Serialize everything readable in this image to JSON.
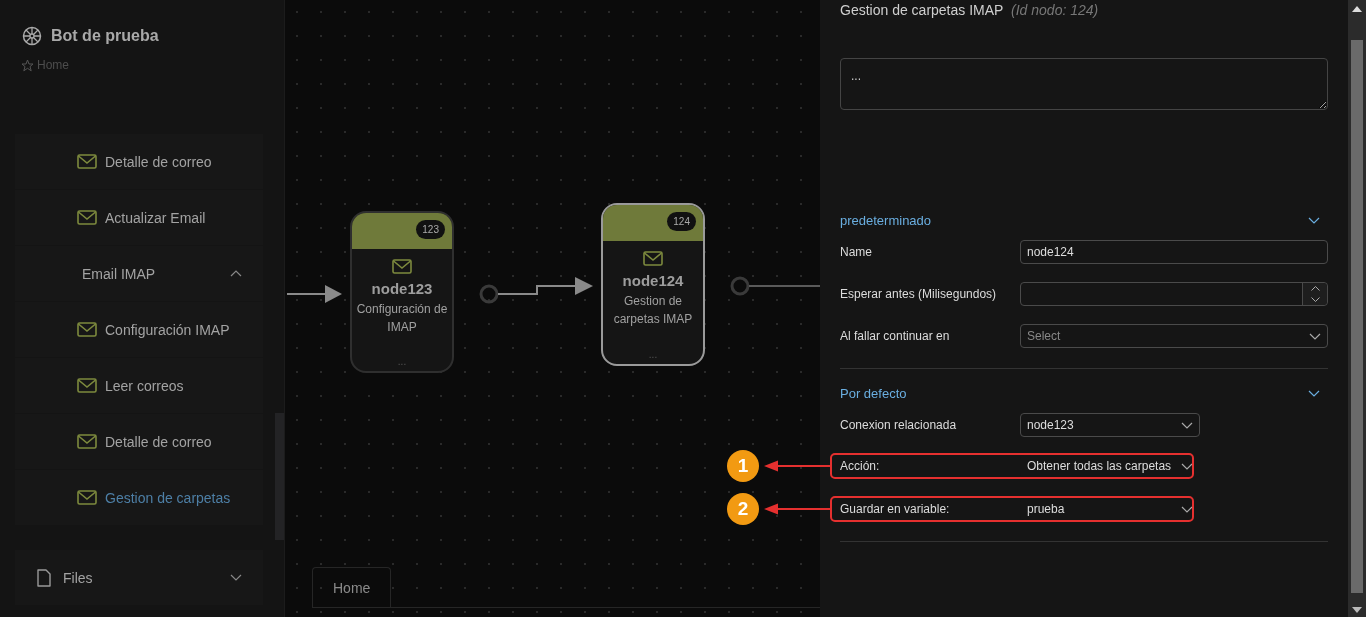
{
  "app": {
    "title": "Bot de prueba",
    "breadcrumb": "Home"
  },
  "sidebar": {
    "items": [
      {
        "kind": "item",
        "label": "Detalle de correo",
        "selected": false
      },
      {
        "kind": "item",
        "label": "Actualizar Email",
        "selected": false
      },
      {
        "kind": "group",
        "label": "Email IMAP",
        "expanded": true,
        "children": [
          {
            "kind": "item",
            "label": "Configuración IMAP",
            "selected": false
          },
          {
            "kind": "item",
            "label": "Leer correos",
            "selected": false
          },
          {
            "kind": "item",
            "label": "Detalle de correo",
            "selected": false
          },
          {
            "kind": "item",
            "label": "Gestion de carpetas",
            "selected": true
          }
        ]
      },
      {
        "kind": "section",
        "label": "Files",
        "expanded": false
      }
    ]
  },
  "canvas": {
    "nodes": [
      {
        "name": "node123",
        "description": "Configuración de IMAP",
        "badge": "123",
        "more": "...",
        "selected": false
      },
      {
        "name": "node124",
        "description": "Gestion de carpetas IMAP",
        "badge": "124",
        "more": "...",
        "selected": true
      }
    ],
    "tabs": [
      {
        "label": "Home",
        "selected": true
      }
    ]
  },
  "panel": {
    "title": "Gestion de carpetas IMAP",
    "subtitle": "(Id nodo: 124)",
    "notes": "...",
    "sections": [
      {
        "title": "predeterminado",
        "expanded": true,
        "fields": [
          {
            "kind": "text",
            "label": "Name",
            "value": "node124"
          },
          {
            "kind": "number",
            "label": "Esperar antes (Milisegundos)"
          },
          {
            "kind": "select",
            "label": "Al fallar continuar en",
            "placeholder": "Select"
          }
        ]
      },
      {
        "title": "Por defecto",
        "expanded": true,
        "fields": [
          {
            "kind": "select",
            "label": "Conexion relacionada",
            "value": "node123"
          },
          {
            "kind": "select",
            "label": "Acción:",
            "value": "Obtener todas las carpetas",
            "callout": "1"
          },
          {
            "kind": "select",
            "label": "Guardar en variable:",
            "value": "prueba",
            "callout": "2"
          }
        ]
      }
    ]
  }
}
